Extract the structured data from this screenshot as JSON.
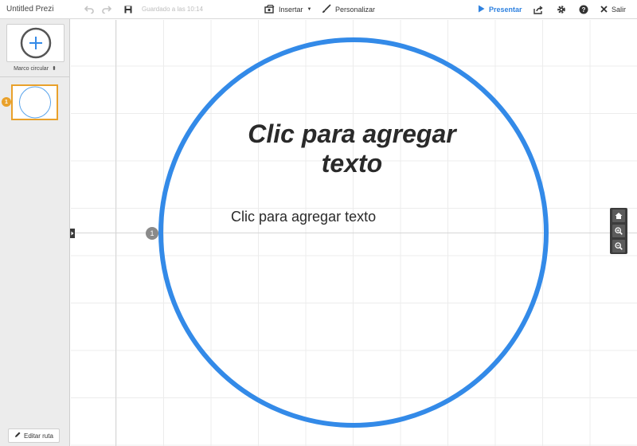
{
  "app": {
    "title": "Untitled Prezi"
  },
  "toolbar": {
    "saved_status": "Guardado a las 10:14",
    "insert_label": "Insertar",
    "customize_label": "Personalizar",
    "present_label": "Presentar",
    "exit_label": "Salir"
  },
  "sidebar": {
    "frame_type_label": "Marco circular",
    "slides": [
      {
        "number": "1"
      }
    ],
    "edit_path_label": "Editar ruta"
  },
  "canvas": {
    "title_placeholder": "Clic para agregar texto",
    "body_placeholder": "Clic para agregar texto",
    "path_step": "1"
  },
  "icons": {
    "undo": "undo-icon",
    "redo": "redo-icon",
    "save": "save-icon",
    "insert": "insert-icon",
    "customize": "brush-icon",
    "present": "play-icon",
    "share": "share-icon",
    "settings": "gear-icon",
    "help": "help-icon",
    "exit": "close-icon",
    "zoom_home": "home-icon",
    "zoom_in": "zoom-in-icon",
    "zoom_out": "zoom-out-icon"
  },
  "colors": {
    "accent": "#338ae8",
    "highlight": "#e9a12b"
  }
}
